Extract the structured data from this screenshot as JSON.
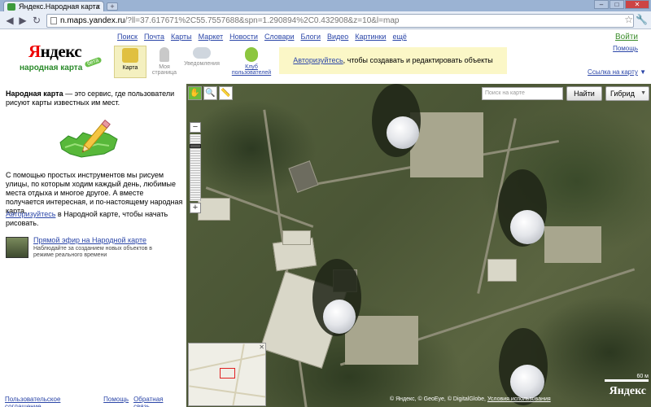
{
  "browser": {
    "tab_title": "Яндекс.Народная карта",
    "new_tab": "+",
    "address_host": "n.maps.yandex.ru",
    "address_path": "/?ll=37.617671%2C55.7557688&spn=1.290894%2C0.432908&z=10&l=map",
    "nav_back": "◀",
    "nav_forward": "▶",
    "nav_reload": "↻",
    "star": "☆",
    "wrench": "🔧",
    "win_min": "–",
    "win_max": "□",
    "win_close": "✕",
    "tab_close": "x"
  },
  "header": {
    "logo_first": "Я",
    "logo_rest": "ндекс",
    "logo_sub": "народная карта",
    "beta": "бета",
    "top_nav": [
      "Поиск",
      "Почта",
      "Карты",
      "Маркет",
      "Новости",
      "Словари",
      "Блоги",
      "Видео",
      "Картинки",
      "ещё"
    ],
    "login": "Войти",
    "help": "Помощь",
    "tools": {
      "map": "Карта",
      "my_page_1": "Моя",
      "my_page_2": "страница",
      "notifications": "Уведомления",
      "club_1": "Клуб",
      "club_2": "пользователей"
    },
    "auth_link": "Авторизуйтесь",
    "auth_rest": ", чтобы создавать и редактировать объекты",
    "map_select": "Ссылка на карту",
    "map_select_arrow": "▼"
  },
  "sidebar": {
    "intro_bold": "Народная карта",
    "intro_rest": " — это сервис, где пользователи рисуют карты известных им мест.",
    "description": "С помощью простых инструментов мы рисуем улицы, по которым ходим каждый день, любимые места отдыха и многое другое. А вместе получается интересная, и по-настоящему народная карта.",
    "auth_link": "Авторизуйтесь",
    "auth_rest": " в Народной карте, чтобы начать рисовать.",
    "live_title": "Прямой эфир на Народной карте",
    "live_sub": "Наблюдайте за созданием новых объектов в режиме реального времени",
    "footer": [
      "Пользовательское соглашение",
      "Помощь",
      "Обратная связь"
    ]
  },
  "map": {
    "search_placeholder": "Поиск на карте",
    "find_button": "Найти",
    "layer": "Гибрид",
    "layer_arrow": "▼",
    "zoom_in": "+",
    "zoom_out": "−",
    "zoom_level_fraction": 0.15,
    "tool_hand": "✋",
    "tool_zoom": "🔍",
    "tool_ruler": "📏",
    "minimap_close": "✕",
    "scale_label": "60 м",
    "logo": "Яндекс",
    "copyright_prefix": "© Яндекс, © GeoEye, © DigitalGlobe,",
    "copyright_link": "Условия использования"
  }
}
